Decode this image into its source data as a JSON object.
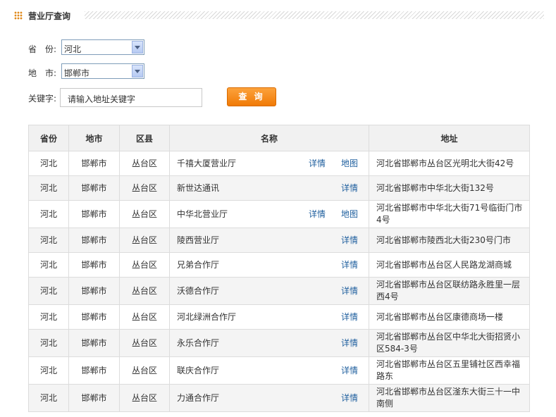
{
  "section": {
    "title": "营业厅查询"
  },
  "form": {
    "province_label": "省　份:",
    "province_value": "河北",
    "city_label": "地　市:",
    "city_value": "邯郸市",
    "keyword_label": "关键字:",
    "keyword_placeholder": "请输入地址关键字",
    "search_button": "查 询"
  },
  "table": {
    "headers": [
      "省份",
      "地市",
      "区县",
      "名称",
      "地址"
    ],
    "rows": [
      {
        "province": "河北",
        "city": "邯郸市",
        "district": "丛台区",
        "name": "千禧大厦营业厅",
        "detail": "详情",
        "map": "地图",
        "address": "河北省邯郸市丛台区光明北大街42号"
      },
      {
        "province": "河北",
        "city": "邯郸市",
        "district": "丛台区",
        "name": "新世达通讯",
        "detail": "详情",
        "address": "河北省邯郸市中华北大街132号"
      },
      {
        "province": "河北",
        "city": "邯郸市",
        "district": "丛台区",
        "name": "中华北营业厅",
        "detail": "详情",
        "map": "地图",
        "address": "河北省邯郸市中华北大街71号临街门市4号"
      },
      {
        "province": "河北",
        "city": "邯郸市",
        "district": "丛台区",
        "name": "陵西营业厅",
        "detail": "详情",
        "address": "河北省邯郸市陵西北大街230号门市"
      },
      {
        "province": "河北",
        "city": "邯郸市",
        "district": "丛台区",
        "name": "兄弟合作厅",
        "detail": "详情",
        "address": "河北省邯郸市丛台区人民路龙湖商城"
      },
      {
        "province": "河北",
        "city": "邯郸市",
        "district": "丛台区",
        "name": "沃德合作厅",
        "detail": "详情",
        "address": "河北省邯郸市丛台区联纺路永胜里一层西4号"
      },
      {
        "province": "河北",
        "city": "邯郸市",
        "district": "丛台区",
        "name": "河北绿洲合作厅",
        "detail": "详情",
        "address": "河北省邯郸市丛台区康德商场一楼"
      },
      {
        "province": "河北",
        "city": "邯郸市",
        "district": "丛台区",
        "name": "永乐合作厅",
        "detail": "详情",
        "address": "河北省邯郸市丛台区中华北大街招贤小区584-3号"
      },
      {
        "province": "河北",
        "city": "邯郸市",
        "district": "丛台区",
        "name": "联庆合作厅",
        "detail": "详情",
        "address": "河北省邯郸市丛台区五里铺社区西幸福路东"
      },
      {
        "province": "河北",
        "city": "邯郸市",
        "district": "丛台区",
        "name": "力通合作厅",
        "detail": "详情",
        "address": "河北省邯郸市丛台区滏东大街三十一中南侧"
      }
    ]
  }
}
